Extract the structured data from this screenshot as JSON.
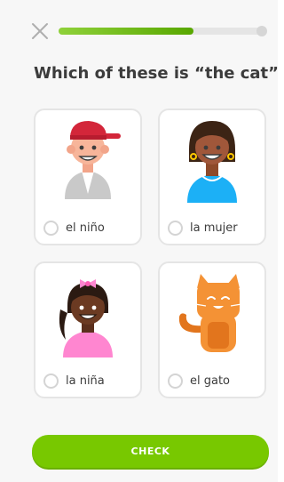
{
  "lesson": {
    "progress": 0.65,
    "close_icon": "close-icon"
  },
  "question": {
    "text": "Which of these is “the cat”"
  },
  "options": [
    {
      "label": "el niño",
      "icon": "boy-illustration"
    },
    {
      "label": "la mujer",
      "icon": "woman-illustration"
    },
    {
      "label": "la niña",
      "icon": "girl-illustration"
    },
    {
      "label": "el gato",
      "icon": "cat-illustration"
    }
  ],
  "footer": {
    "check_label": "CHECK"
  },
  "colors": {
    "accent": "#78c800",
    "border": "#e5e5e5",
    "text": "#3c3c3c"
  }
}
